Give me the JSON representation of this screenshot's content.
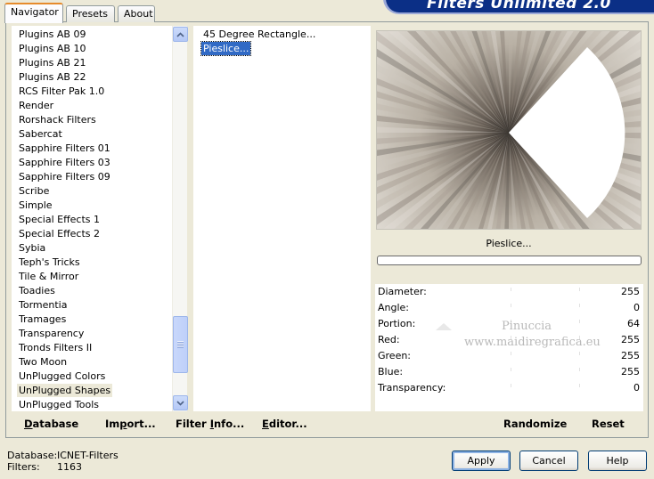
{
  "tabs": [
    {
      "label": "Navigator",
      "active": true
    },
    {
      "label": "Presets",
      "active": false
    },
    {
      "label": "About",
      "active": false
    }
  ],
  "banner": {
    "title": "Filters Unlimited 2.0"
  },
  "categories": {
    "items": [
      "Plugins AB 09",
      "Plugins AB 10",
      "Plugins AB 21",
      "Plugins AB 22",
      "RCS Filter Pak 1.0",
      "Render",
      "Rorshack Filters",
      "Sabercat",
      "Sapphire Filters 01",
      "Sapphire Filters 03",
      "Sapphire Filters 09",
      "Scribe",
      "Simple",
      "Special Effects 1",
      "Special Effects 2",
      "Sybia",
      "Teph's Tricks",
      "Tile & Mirror",
      "Toadies",
      "Tormentia",
      "Tramages",
      "Transparency",
      "Tronds Filters II",
      "Two Moon",
      "UnPlugged Colors",
      "UnPlugged Shapes",
      "UnPlugged Tools"
    ],
    "selected": "UnPlugged Shapes"
  },
  "filters": {
    "items": [
      "45 Degree Rectangle...",
      "Pieslice..."
    ],
    "selected": "Pieslice..."
  },
  "preview": {
    "filter_name": "Pieslice...",
    "progress_percent": 0
  },
  "params": [
    {
      "label": "Diameter:",
      "value": "255"
    },
    {
      "label": "Angle:",
      "value": "0"
    },
    {
      "label": "Portion:",
      "value": "64"
    },
    {
      "label": "Red:",
      "value": "255"
    },
    {
      "label": "Green:",
      "value": "255"
    },
    {
      "label": "Blue:",
      "value": "255"
    },
    {
      "label": "Transparency:",
      "value": "0"
    }
  ],
  "watermark": {
    "line1": "Pinuccia",
    "line2": "www.maidiregrafica.eu"
  },
  "toolbar_left": {
    "database": {
      "underlined": "D",
      "rest": "atabase"
    },
    "import": {
      "before": "Im",
      "underlined": "p",
      "rest": "ort..."
    },
    "filter_info": {
      "before": "Filter ",
      "underlined": "I",
      "rest": "nfo..."
    },
    "editor": {
      "underlined": "E",
      "rest": "ditor..."
    }
  },
  "toolbar_right": {
    "randomize": "Randomize",
    "reset": "Reset"
  },
  "status": {
    "database_label": "Database:",
    "database_value": "ICNET-Filters",
    "filters_label": "Filters:",
    "filters_value": "1163"
  },
  "dialog_buttons": {
    "apply": "Apply",
    "cancel": "Cancel",
    "help": "Help"
  },
  "colors": {
    "selection": "#316ac5",
    "banner": "#0b2f86",
    "tab_accent": "#e68b2c",
    "face": "#ece9d8"
  }
}
